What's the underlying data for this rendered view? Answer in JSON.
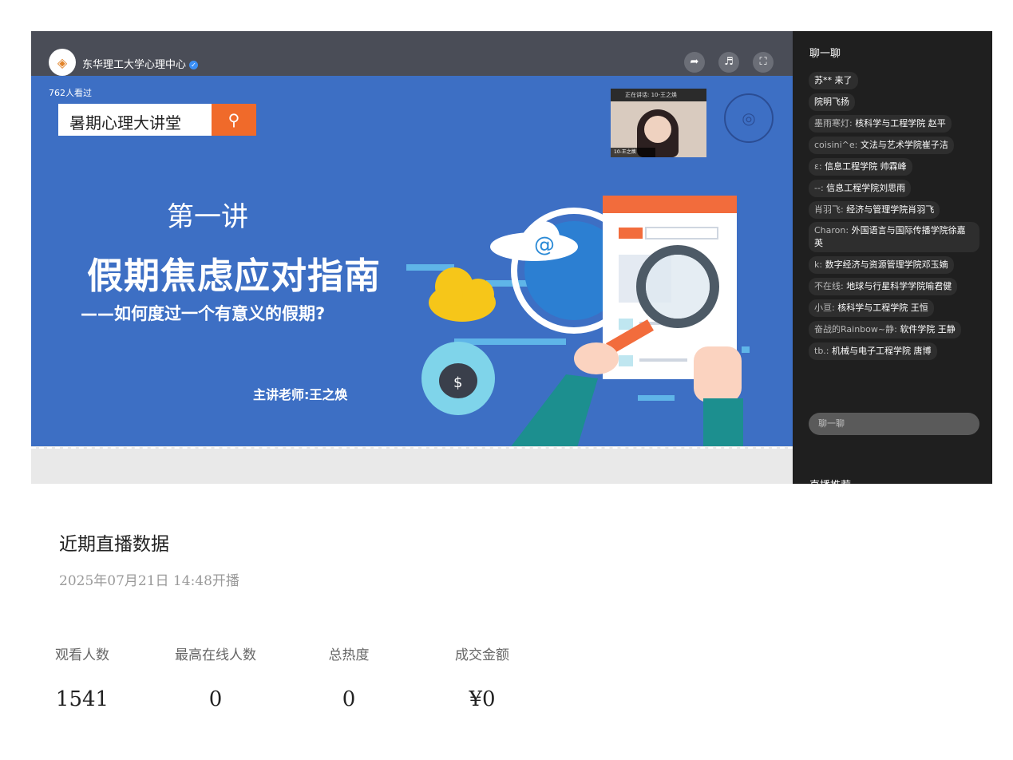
{
  "player": {
    "channel_name": "东华理工大学心理中心",
    "viewers_text": "762人看过",
    "search_text": "暑期心理大讲堂",
    "slide": {
      "lesson": "第一讲",
      "title": "假期焦虑应对指南",
      "subtitle": "——如何度过一个有意义的假期?",
      "teacher": "主讲老师:王之焕"
    },
    "camera": {
      "header": "正在讲话: 10-王之焕",
      "footer": "10-王之焕"
    }
  },
  "chat": {
    "title": "聊一聊",
    "messages": [
      {
        "nick": "",
        "text": "苏** 来了"
      },
      {
        "nick": "",
        "text": "院明飞扬"
      },
      {
        "nick": "墨雨寒灯:",
        "text": "核科学与工程学院 赵平"
      },
      {
        "nick": "coisini^e:",
        "text": "文法与艺术学院崔子洁"
      },
      {
        "nick": "ε:",
        "text": "信息工程学院 帅霖峰"
      },
      {
        "nick": "--:",
        "text": "信息工程学院刘思雨"
      },
      {
        "nick": "肖羽飞:",
        "text": "经济与管理学院肖羽飞"
      },
      {
        "nick": "Charon:",
        "text": "外国语言与国际传播学院徐嘉英"
      },
      {
        "nick": "k:",
        "text": "数字经济与资源管理学院邓玉婻"
      },
      {
        "nick": "不在线:",
        "text": "地球与行星科学学院喻君健"
      },
      {
        "nick": "小亘:",
        "text": "核科学与工程学院 王恒"
      },
      {
        "nick": "奋战的Rainbow~静:",
        "text": "软件学院 王静"
      },
      {
        "nick": "tb.:",
        "text": "机械与电子工程学院 唐博"
      }
    ],
    "input_placeholder": "聊一聊",
    "recommend_label": "直播推荐"
  },
  "stats": {
    "section_title": "近期直播数据",
    "start_time": "2025年07月21日 14:48开播",
    "items": [
      {
        "label": "观看人数",
        "value": "1541"
      },
      {
        "label": "最高在线人数",
        "value": "0"
      },
      {
        "label": "总热度",
        "value": "0"
      },
      {
        "label": "成交金额",
        "value": "¥0"
      }
    ]
  }
}
